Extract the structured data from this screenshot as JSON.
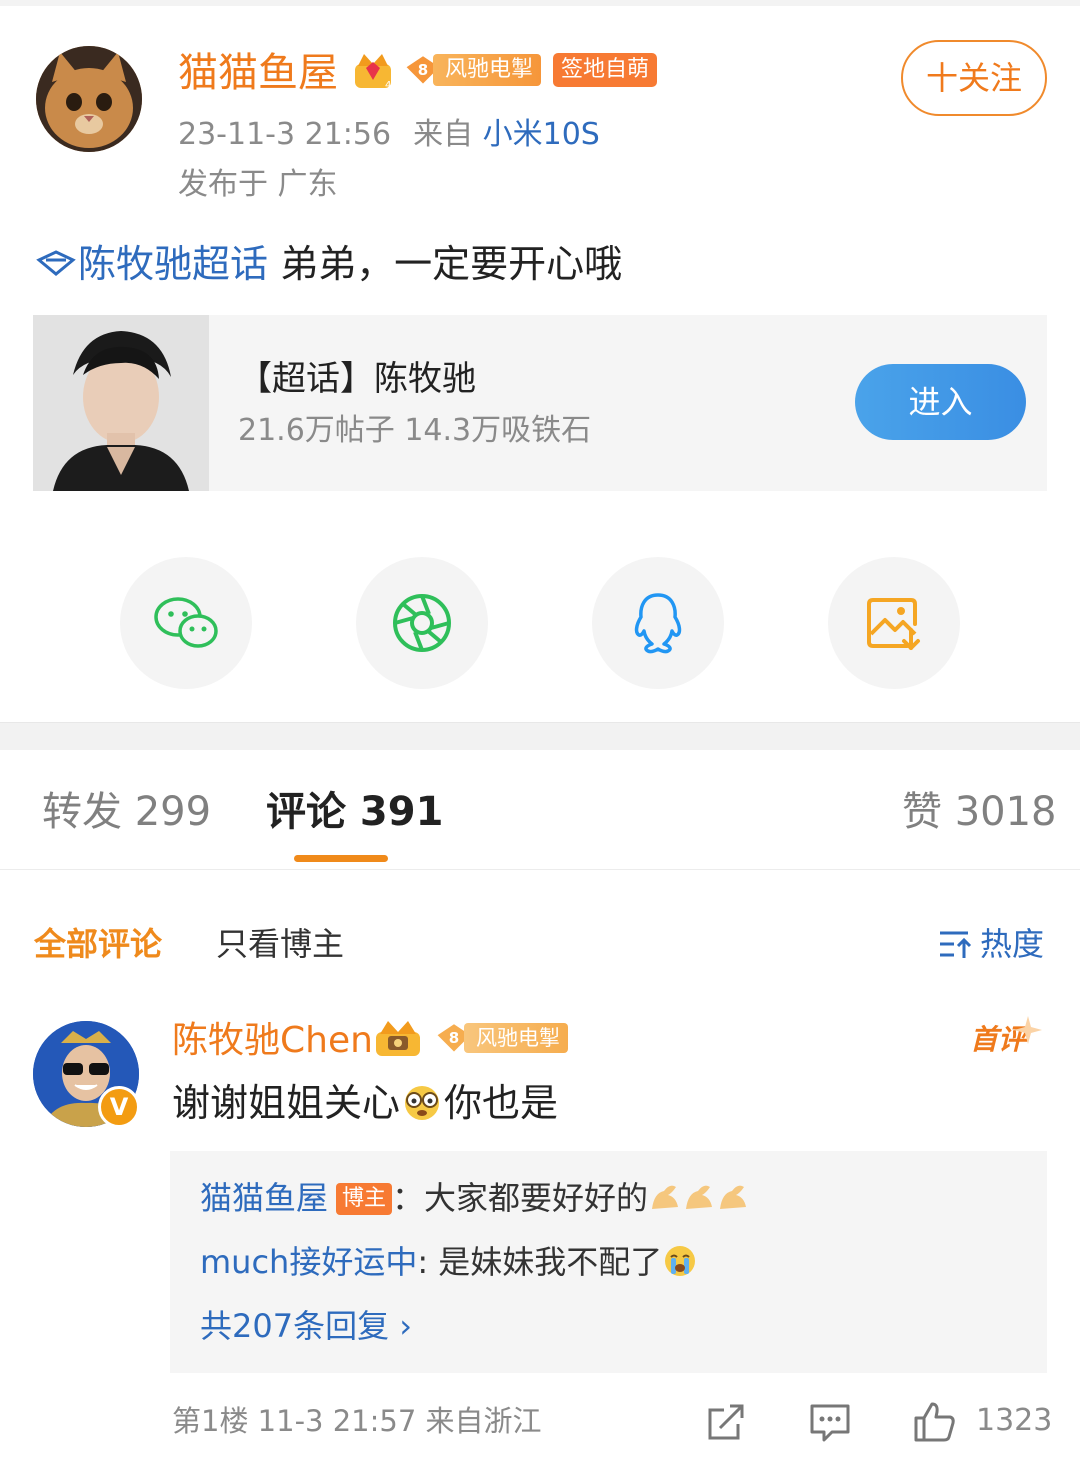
{
  "post": {
    "author": "猫猫鱼屋",
    "fan_badge_level": "8",
    "fan_badge_text": "风驰电掣",
    "sign_badge": "签地自萌",
    "follow_label": "十关注",
    "time": "23-11-3 21:56",
    "from_label": "来自",
    "device": "小米10S",
    "location": "发布于 广东",
    "topic": "陈牧驰超话",
    "text": " 弟弟，一定要开心哦"
  },
  "topic_card": {
    "title": "【超话】陈牧驰",
    "stats": "21.6万帖子 14.3万吸铁石",
    "enter_label": "进入"
  },
  "share": {
    "icons": [
      "wechat-icon",
      "moments-icon",
      "qq-icon",
      "save-image-icon"
    ],
    "colors": [
      "#2fbf5a",
      "#2fbf5a",
      "#2196f3",
      "#f5a623"
    ]
  },
  "tabs": {
    "repost": "转发 299",
    "comments": "评论 391",
    "likes": "赞 3018"
  },
  "filters": {
    "all": "全部评论",
    "owner_only": "只看博主",
    "sort": "热度"
  },
  "comment": {
    "name": "陈牧驰Chen",
    "fan_badge_level": "8",
    "fan_badge_text": "风驰电掣",
    "first_tag": "首评",
    "verified": "V",
    "text_a": "谢谢姐姐关心",
    "text_b": "你也是",
    "replies": [
      {
        "name": "猫猫鱼屋",
        "owner_tag": "博主",
        "sep": "：",
        "text": "大家都要好好的"
      },
      {
        "name": "much接好运中",
        "sep": ": ",
        "text": "是妹妹我不配了"
      }
    ],
    "more": "共207条回复 ",
    "more_arrow": "›",
    "floor": "第1楼",
    "time": "11-3 21:57",
    "from": "来自浙江",
    "like_count": "1323"
  }
}
